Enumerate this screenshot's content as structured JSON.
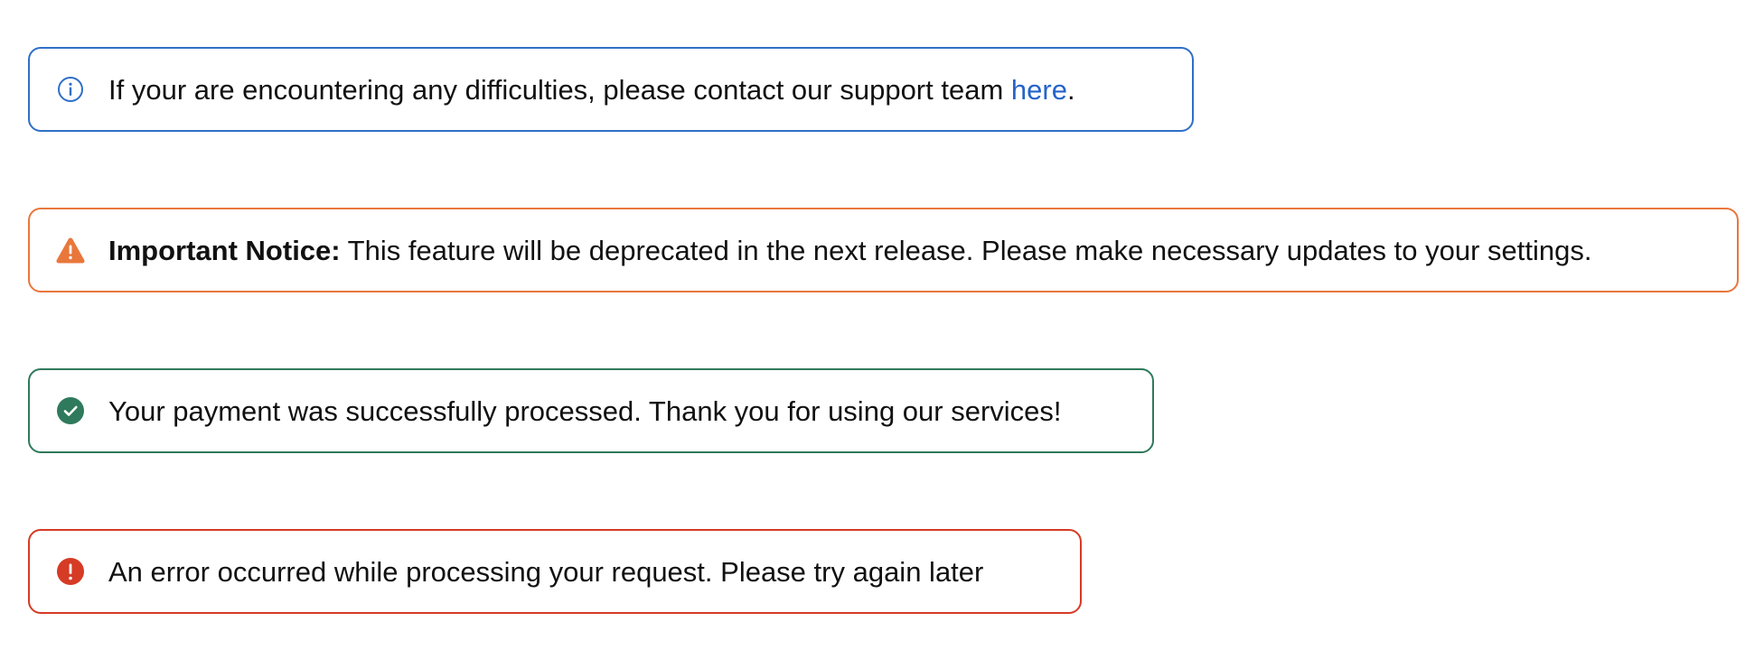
{
  "alerts": {
    "info": {
      "icon": "info-circle-icon",
      "color": "#2f6fc7",
      "text_before_link": "If your are encountering any difficulties, please contact our support team ",
      "link_label": "here",
      "text_after_link": "."
    },
    "warning": {
      "icon": "warning-triangle-icon",
      "color": "#e9773c",
      "title": "Important Notice:",
      "text": " This feature will be deprecated in the next release. Please make necessary updates to your settings."
    },
    "success": {
      "icon": "check-circle-icon",
      "color": "#2f7a5c",
      "text": "Your payment was successfully processed. Thank you for using our services!"
    },
    "error": {
      "icon": "exclamation-circle-icon",
      "color": "#d63b25",
      "text": "An error occurred while processing your request. Please try again later"
    }
  },
  "link_color": "#2563c9"
}
